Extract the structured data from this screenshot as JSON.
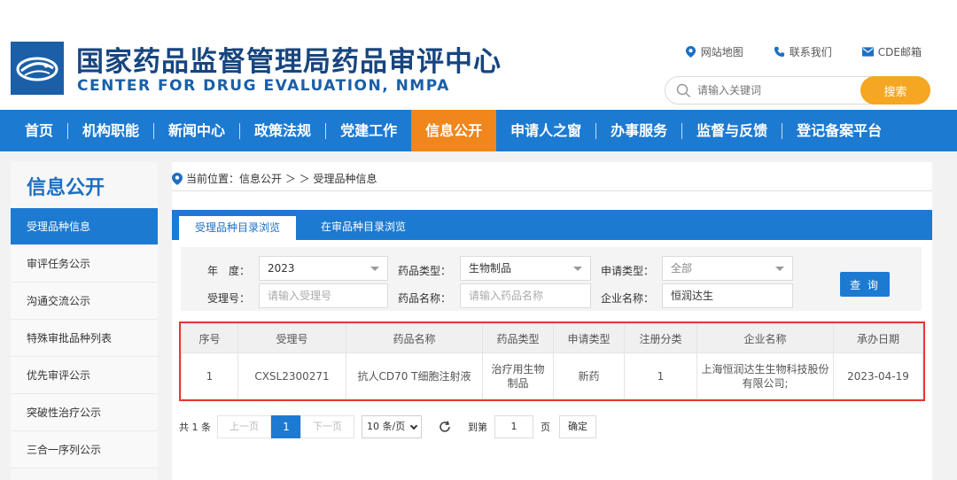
{
  "header": {
    "title_cn": "国家药品监督管理局药品审评中心",
    "title_en": "CENTER FOR DRUG EVALUATION, NMPA",
    "links": [
      {
        "label": "网站地图",
        "icon": "location-pin-icon"
      },
      {
        "label": "联系我们",
        "icon": "phone-icon"
      },
      {
        "label": "CDE邮箱",
        "icon": "mail-icon"
      }
    ],
    "search": {
      "placeholder": "请输入关键词",
      "button": "搜索"
    }
  },
  "nav": {
    "items": [
      "首页",
      "机构职能",
      "新闻中心",
      "政策法规",
      "党建工作",
      "信息公开",
      "申请人之窗",
      "办事服务",
      "监督与反馈",
      "登记备案平台"
    ],
    "active": "信息公开"
  },
  "sidebar": {
    "title": "信息公开",
    "items": [
      "受理品种信息",
      "审评任务公示",
      "沟通交流公示",
      "特殊审批品种列表",
      "优先审评公示",
      "突破性治疗公示",
      "三合一序列公示"
    ]
  },
  "breadcrumb": {
    "text": "当前位置：信息公开 ＞ ＞ 受理品种信息"
  },
  "tabs": [
    {
      "label": "受理品种目录浏览"
    },
    {
      "label": "在审品种目录浏览"
    }
  ],
  "filters": {
    "year_label": "年　度：",
    "year_value": "2023",
    "drug_type_label": "药品类型：",
    "drug_type_value": "生物制品",
    "apply_type_label": "申请类型：",
    "apply_type_value": "全部",
    "accept_no_label": "受理号：",
    "accept_no_placeholder": "请输入受理号",
    "drug_name_label": "药品名称：",
    "drug_name_placeholder": "请输入药品名称",
    "company_label": "企业名称：",
    "company_value": "恒润达生",
    "query_button": "查 询"
  },
  "table": {
    "headers": [
      "序号",
      "受理号",
      "药品名称",
      "药品类型",
      "申请类型",
      "注册分类",
      "企业名称",
      "承办日期"
    ],
    "rows": [
      [
        "1",
        "CXSL2300271",
        "抗人CD70 T细胞注射液",
        "治疗用生物制品",
        "新药",
        "1",
        "上海恒润达生生物科技股份有限公司;",
        "2023-04-19"
      ]
    ]
  },
  "pager": {
    "total": "共 1 条",
    "prev": "上一页",
    "current": "1",
    "next": "下一页",
    "page_size": "10 条/页",
    "goto_label": "到第",
    "goto_value": "1",
    "page_unit": "页",
    "confirm": "确定"
  },
  "colors": {
    "primary": "#1d7ad1",
    "accent": "#f0861c",
    "search_button": "#f5a623",
    "highlight_border": "#e53935"
  }
}
